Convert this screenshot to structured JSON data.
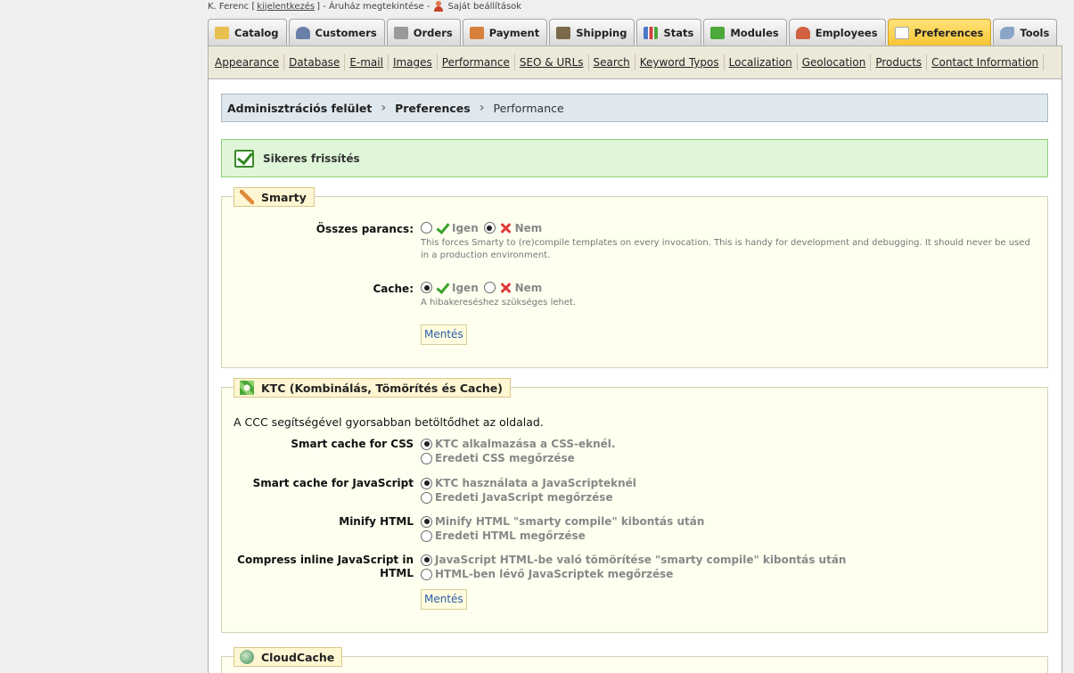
{
  "topbar": {
    "user": "K. Ferenc [",
    "logout": "kijelentkezés",
    "user_end": "] -",
    "shop_view": "Áruház megtekintése -",
    "my_settings": "Saját beállítások"
  },
  "tabs": [
    {
      "label": "Catalog",
      "icon": "folder-icon",
      "color": "#e8c050"
    },
    {
      "label": "Customers",
      "icon": "customer-icon",
      "color": "#6a7fa8"
    },
    {
      "label": "Orders",
      "icon": "cart-icon",
      "color": "#9a9a9a"
    },
    {
      "label": "Payment",
      "icon": "payment-icon",
      "color": "#d8803a"
    },
    {
      "label": "Shipping",
      "icon": "truck-icon",
      "color": "#7a6a4a"
    },
    {
      "label": "Stats",
      "icon": "chart-icon",
      "color": "#4a78c8"
    },
    {
      "label": "Modules",
      "icon": "puzzle-icon",
      "color": "#4ca83a"
    },
    {
      "label": "Employees",
      "icon": "employee-icon",
      "color": "#d06040"
    },
    {
      "label": "Preferences",
      "icon": "preferences-icon",
      "color": "#f0f0f0",
      "active": true
    },
    {
      "label": "Tools",
      "icon": "wrench-icon",
      "color": "#8aa4c8"
    }
  ],
  "subnav": [
    "Appearance",
    "Database",
    "E-mail",
    "Images",
    "Performance",
    "SEO & URLs",
    "Search",
    "Keyword Typos",
    "Localization",
    "Geolocation",
    "Products",
    "Contact Information"
  ],
  "breadcrumb": {
    "root": "Adminisztrációs felület",
    "section": "Preferences",
    "current": "Performance"
  },
  "success": "Sikeres frissítés",
  "smarty": {
    "title": "Smarty",
    "force_compile": {
      "label": "Összes parancs:",
      "yes": "Igen",
      "no": "Nem",
      "selected": "no",
      "hint": "This forces Smarty to (re)compile templates on every invocation. This is handy for development and debugging. It should never be used in a production environment."
    },
    "cache": {
      "label": "Cache:",
      "yes": "Igen",
      "no": "Nem",
      "selected": "yes",
      "hint": "A hibakereséshez szükséges lehet."
    },
    "save": "Mentés"
  },
  "ktc": {
    "title": "KTC (Kombinálás, Tömörítés és Cache)",
    "intro": "A CCC segítségével gyorsabban betöltődhet az oldalad.",
    "rows": [
      {
        "label": "Smart cache for CSS",
        "opt1": "KTC alkalmazása a CSS-eknél.",
        "opt2": "Eredeti CSS megőrzése"
      },
      {
        "label": "Smart cache for JavaScript",
        "opt1": "KTC használata a JavaScripteknél",
        "opt2": "Eredeti JavaScript megőrzése"
      },
      {
        "label": "Minify HTML",
        "opt1": "Minify HTML \"smarty compile\" kibontás után",
        "opt2": "Eredeti HTML megőrzése"
      },
      {
        "label": "Compress inline JavaScript in HTML",
        "opt1": "JavaScript HTML-be való tömörítése \"smarty compile\" kibontás után",
        "opt2": "HTML-ben lévő JavaScriptek megőrzése"
      }
    ],
    "save": "Mentés"
  },
  "cloudcache": {
    "title": "CloudCache"
  }
}
